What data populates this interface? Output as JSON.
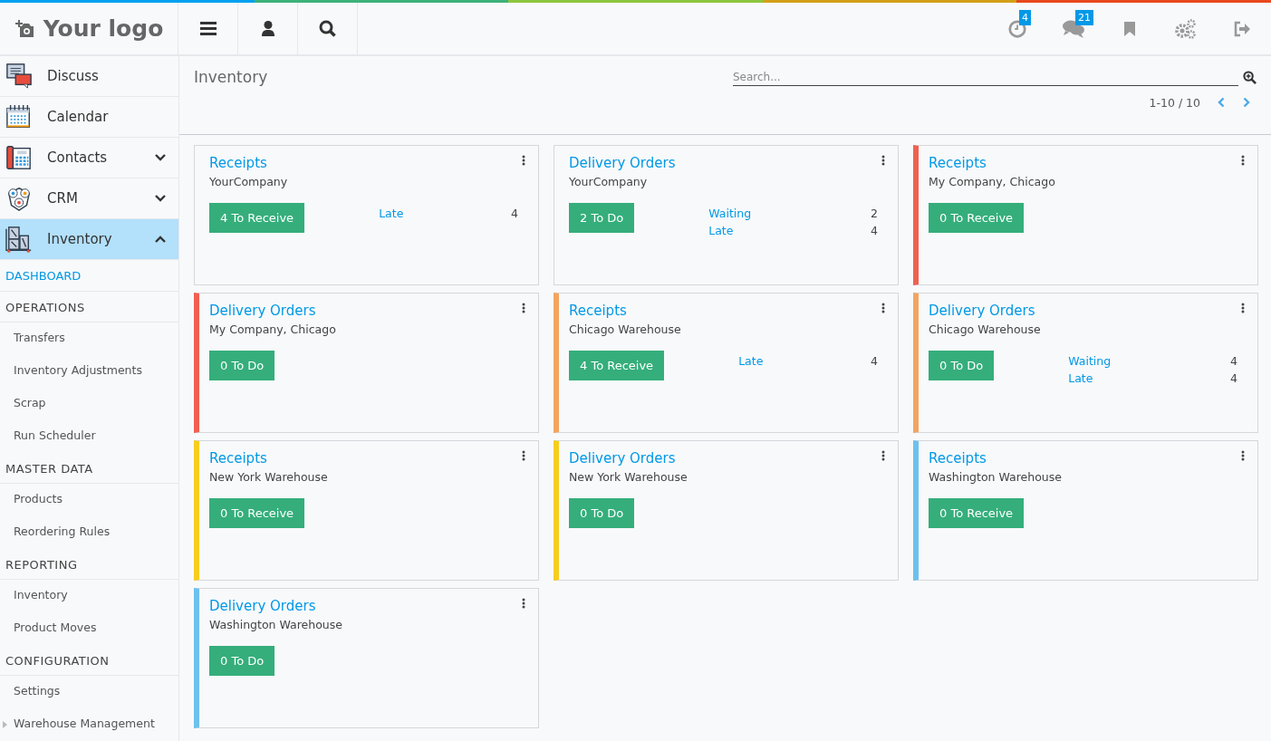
{
  "topbar": {
    "logo": "Your logo",
    "systray": [
      {
        "kind": "clock",
        "badge": "4"
      },
      {
        "kind": "chat",
        "badge": "21"
      },
      {
        "kind": "bookmark"
      },
      {
        "kind": "gears"
      },
      {
        "kind": "logout"
      }
    ]
  },
  "sidebar": {
    "apps": [
      {
        "label": "Discuss",
        "kind": "discuss",
        "selected": false
      },
      {
        "label": "Calendar",
        "kind": "calendar",
        "selected": false
      },
      {
        "label": "Contacts",
        "kind": "contacts",
        "selected": false,
        "expanded": false
      },
      {
        "label": "CRM",
        "kind": "crm",
        "selected": false,
        "expanded": false
      },
      {
        "label": "Inventory",
        "kind": "inventory",
        "selected": true,
        "expanded": true
      }
    ],
    "menu": [
      {
        "kind": "link",
        "label": "DASHBOARD",
        "selected": true
      },
      {
        "kind": "section",
        "label": "OPERATIONS",
        "items": [
          {
            "label": "Transfers",
            "collapsed": false
          },
          {
            "label": "Inventory Adjustments",
            "collapsed": false
          },
          {
            "label": "Scrap",
            "collapsed": false
          },
          {
            "label": "Run Scheduler",
            "collapsed": false
          }
        ]
      },
      {
        "kind": "section",
        "label": "MASTER DATA",
        "items": [
          {
            "label": "Products",
            "collapsed": false
          },
          {
            "label": "Reordering Rules",
            "collapsed": false
          }
        ]
      },
      {
        "kind": "section",
        "label": "REPORTING",
        "items": [
          {
            "label": "Inventory",
            "collapsed": false
          },
          {
            "label": "Product Moves",
            "collapsed": false
          }
        ]
      },
      {
        "kind": "section",
        "label": "CONFIGURATION",
        "items": [
          {
            "label": "Settings",
            "collapsed": false
          },
          {
            "label": "Warehouse Management",
            "collapsed": true
          }
        ]
      }
    ]
  },
  "control_panel": {
    "title": "Inventory",
    "search": {
      "placeholder": "Search..."
    },
    "pager": "1-10 / 10"
  },
  "cards": [
    {
      "title": "Receipts",
      "subtitle": "YourCompany",
      "button": "4 To Receive",
      "stats": [
        {
          "label": "Late",
          "value": "4"
        }
      ]
    },
    {
      "title": "Delivery Orders",
      "subtitle": "YourCompany",
      "button": "2 To Do",
      "stats": [
        {
          "label": "Waiting",
          "value": "2"
        },
        {
          "label": "Late",
          "value": "4"
        }
      ]
    },
    {
      "title": "Receipts",
      "subtitle": "My Company, Chicago",
      "button": "0 To Receive",
      "color": "#f06050"
    },
    {
      "title": "Delivery Orders",
      "subtitle": "My Company, Chicago",
      "button": "0 To Do",
      "color": "#f06050"
    },
    {
      "title": "Receipts",
      "subtitle": "Chicago Warehouse",
      "button": "4 To Receive",
      "color": "#f4a460",
      "stats": [
        {
          "label": "Late",
          "value": "4"
        }
      ]
    },
    {
      "title": "Delivery Orders",
      "subtitle": "Chicago Warehouse",
      "button": "0 To Do",
      "color": "#f4a460",
      "stats": [
        {
          "label": "Waiting",
          "value": "4"
        },
        {
          "label": "Late",
          "value": "4"
        }
      ]
    },
    {
      "title": "Receipts",
      "subtitle": "New York Warehouse",
      "button": "0 To Receive",
      "color": "#f7cd1f"
    },
    {
      "title": "Delivery Orders",
      "subtitle": "New York Warehouse",
      "button": "0 To Do",
      "color": "#f7cd1f"
    },
    {
      "title": "Receipts",
      "subtitle": "Washington Warehouse",
      "button": "0 To Receive",
      "color": "#6cc1ed"
    },
    {
      "title": "Delivery Orders",
      "subtitle": "Washington Warehouse",
      "button": "0 To Do",
      "color": "#6cc1ed"
    }
  ]
}
